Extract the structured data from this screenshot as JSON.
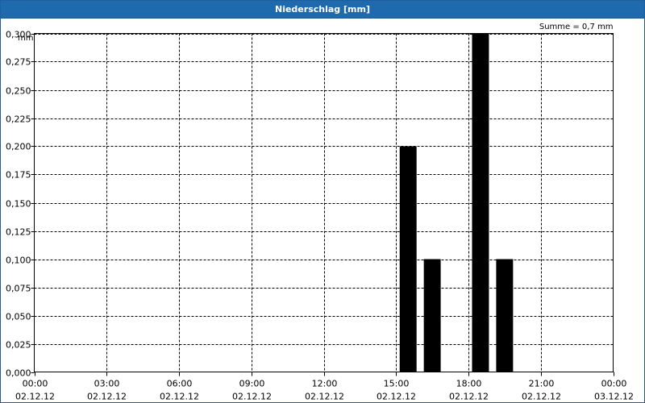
{
  "window": {
    "title": "Niederschlag [mm]"
  },
  "chart_data": {
    "type": "bar",
    "title": "Niederschlag [mm]",
    "ylabel": "mm",
    "annotation": "Summe = 0,7 mm",
    "x_unit": "hours",
    "xlim": [
      0,
      24
    ],
    "ylim": [
      0,
      0.3
    ],
    "grid": true,
    "x_ticks": [
      {
        "value": 0,
        "time": "00:00",
        "date": "02.12.12"
      },
      {
        "value": 3,
        "time": "03:00",
        "date": "02.12.12"
      },
      {
        "value": 6,
        "time": "06:00",
        "date": "02.12.12"
      },
      {
        "value": 9,
        "time": "09:00",
        "date": "02.12.12"
      },
      {
        "value": 12,
        "time": "12:00",
        "date": "02.12.12"
      },
      {
        "value": 15,
        "time": "15:00",
        "date": "02.12.12"
      },
      {
        "value": 18,
        "time": "18:00",
        "date": "02.12.12"
      },
      {
        "value": 21,
        "time": "21:00",
        "date": "02.12.12"
      },
      {
        "value": 24,
        "time": "00:00",
        "date": "03.12.12"
      }
    ],
    "y_ticks": [
      {
        "value": 0,
        "label": "0,000"
      },
      {
        "value": 0.025,
        "label": "0,025"
      },
      {
        "value": 0.05,
        "label": "0,050"
      },
      {
        "value": 0.075,
        "label": "0,075"
      },
      {
        "value": 0.1,
        "label": "0,100"
      },
      {
        "value": 0.125,
        "label": "0,125"
      },
      {
        "value": 0.15,
        "label": "0,150"
      },
      {
        "value": 0.175,
        "label": "0,175"
      },
      {
        "value": 0.2,
        "label": "0,200"
      },
      {
        "value": 0.225,
        "label": "0,225"
      },
      {
        "value": 0.25,
        "label": "0,250"
      },
      {
        "value": 0.275,
        "label": "0,275"
      },
      {
        "value": 0.3,
        "label": "0,300"
      }
    ],
    "bars": [
      {
        "x": 15.5,
        "value": 0.2
      },
      {
        "x": 16.5,
        "value": 0.1
      },
      {
        "x": 18.5,
        "value": 0.3
      },
      {
        "x": 19.5,
        "value": 0.1
      }
    ],
    "bar_color": "#000000"
  }
}
